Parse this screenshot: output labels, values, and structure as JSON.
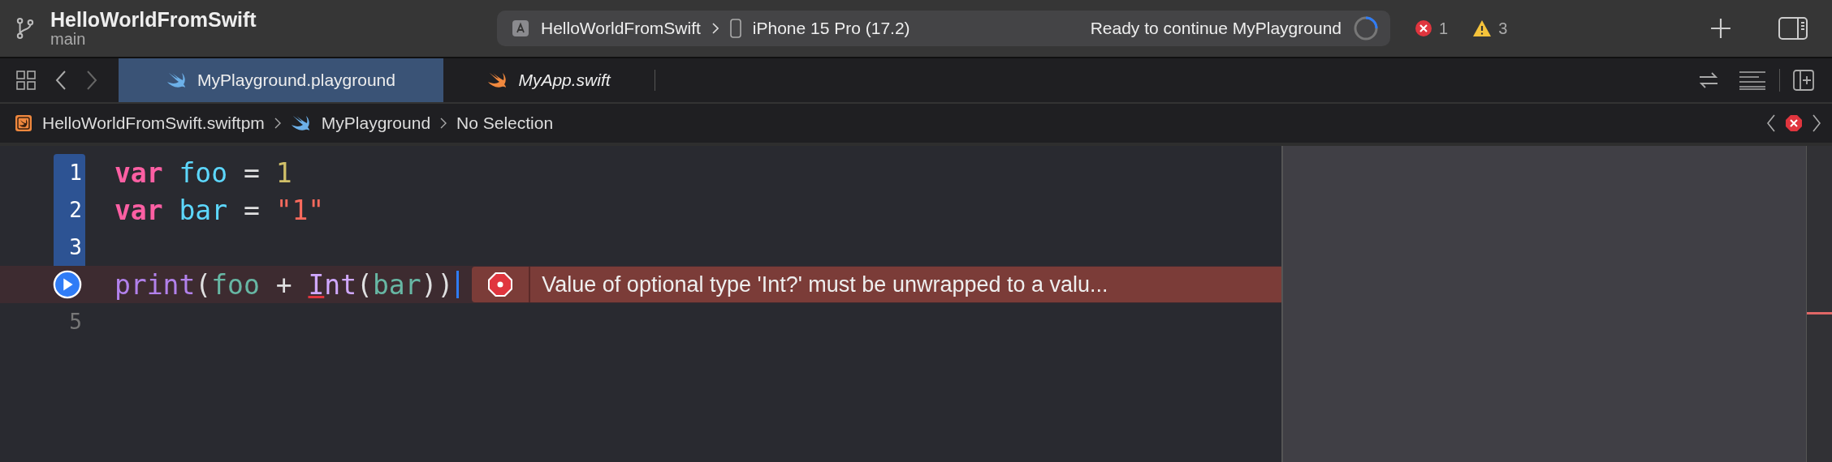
{
  "toolbar": {
    "project": "HelloWorldFromSwift",
    "branch": "main",
    "scheme": "HelloWorldFromSwift",
    "device": "iPhone 15 Pro (17.2)",
    "status": "Ready to continue MyPlayground",
    "errors": "1",
    "warnings": "3"
  },
  "tabs": [
    {
      "label": "MyPlayground.playground",
      "selected": true,
      "preview": false,
      "color": "#6cb0e8"
    },
    {
      "label": "MyApp.swift",
      "selected": false,
      "preview": true,
      "color": "#f0883e"
    }
  ],
  "breadcrumb": [
    {
      "kind": "package",
      "label": "HelloWorldFromSwift.swiftpm"
    },
    {
      "kind": "playground",
      "label": "MyPlayground"
    },
    {
      "kind": "plain",
      "label": "No Selection"
    }
  ],
  "code": [
    {
      "number": "1",
      "kind": "number",
      "selected": true,
      "error": false,
      "tokens": [
        {
          "kind": "keyword",
          "text": "var"
        },
        {
          "kind": "ident",
          "text": "foo"
        },
        {
          "kind": "plain",
          "text": " = "
        },
        {
          "kind": "number",
          "text": "1"
        }
      ]
    },
    {
      "number": "2",
      "kind": "number",
      "selected": true,
      "error": false,
      "tokens": [
        {
          "kind": "keyword",
          "text": "var"
        },
        {
          "kind": "ident",
          "text": "bar"
        },
        {
          "kind": "plain",
          "text": " = "
        },
        {
          "kind": "string",
          "text": "\"1\""
        }
      ]
    },
    {
      "number": "3",
      "kind": "number",
      "selected": true,
      "error": false
    },
    {
      "kind": "run",
      "selected": false,
      "error": true,
      "message": "Value of optional type 'Int?' must be unwrapped to a valu...",
      "tokens": [
        {
          "kind": "func",
          "text": "print"
        },
        {
          "kind": "plain",
          "text": "("
        },
        {
          "kind": "local",
          "text": "foo"
        },
        {
          "kind": "plain",
          "text": " + "
        },
        {
          "kind": "type",
          "text": "I",
          "underlined": true
        },
        {
          "kind": "type",
          "text": "nt"
        },
        {
          "kind": "plain",
          "text": "("
        },
        {
          "kind": "local",
          "text": "bar"
        },
        {
          "kind": "plain",
          "text": "))"
        }
      ]
    },
    {
      "number": "5",
      "kind": "number",
      "selected": false,
      "error": false
    }
  ]
}
